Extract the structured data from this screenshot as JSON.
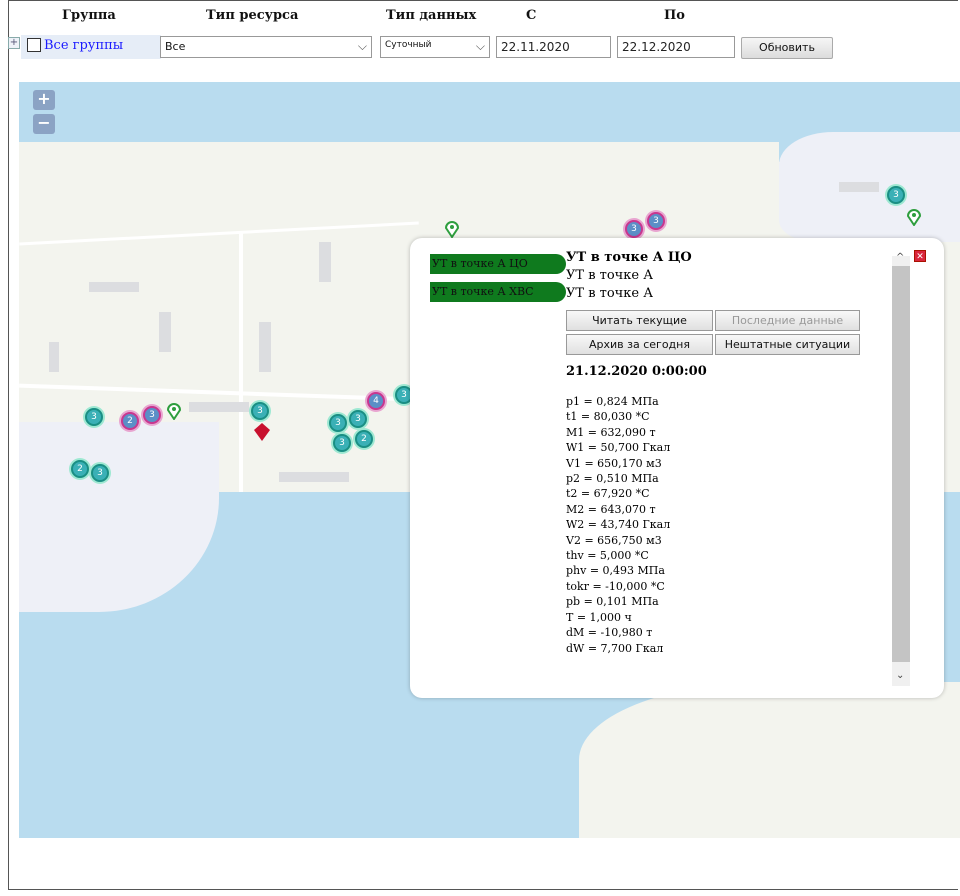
{
  "filters": {
    "headers": {
      "group": "Группа",
      "resource_type": "Тип ресурса",
      "data_type": "Тип данных",
      "from": "С",
      "to": "По"
    },
    "group_link": "Все группы",
    "resource_type_value": "Все",
    "data_type_value": "Суточный",
    "date_from": "22.11.2020",
    "date_to": "22.12.2020",
    "refresh_label": "Обновить"
  },
  "map": {
    "zoom_in": "+",
    "zoom_out": "−",
    "clusters": [
      "3",
      "2",
      "3",
      "2",
      "3",
      "3",
      "3",
      "4",
      "3",
      "3",
      "2",
      "3",
      "3",
      "3",
      "3"
    ]
  },
  "popup": {
    "objects": [
      {
        "label": "УТ в точке А ЦО"
      },
      {
        "label": "УТ в точке А ХВС"
      }
    ],
    "title": "УТ в точке А ЦО",
    "subtitle_1": "УТ в точке А",
    "subtitle_2": "УТ в точке А",
    "buttons": {
      "read_current": "Читать текущие",
      "last_data": "Последние данные",
      "archive_today": "Архив за сегодня",
      "emergency": "Нештатные ситуации"
    },
    "datetime": "21.12.2020 0:00:00",
    "readings": [
      "p1 = 0,824 МПа",
      "t1 = 80,030 *С",
      "M1 = 632,090 т",
      "W1 = 50,700 Гкал",
      "V1 = 650,170 м3",
      "p2 = 0,510 МПа",
      "t2 = 67,920 *С",
      "M2 = 643,070 т",
      "W2 = 43,740 Гкал",
      "V2 = 656,750 м3",
      "thv = 5,000 *С",
      "phv = 0,493 МПа",
      "tokr = -10,000 *С",
      "pb = 0,101 МПа",
      "T = 1,000 ч",
      "dM = -10,980 т",
      "dW = 7,700 Гкал"
    ]
  },
  "colors": {
    "water": "#b9dcef",
    "land": "#f3f4ee",
    "object_tag": "#0f7a1e",
    "marker_red": "#c8102e",
    "marker_green": "#2e9e3e"
  }
}
